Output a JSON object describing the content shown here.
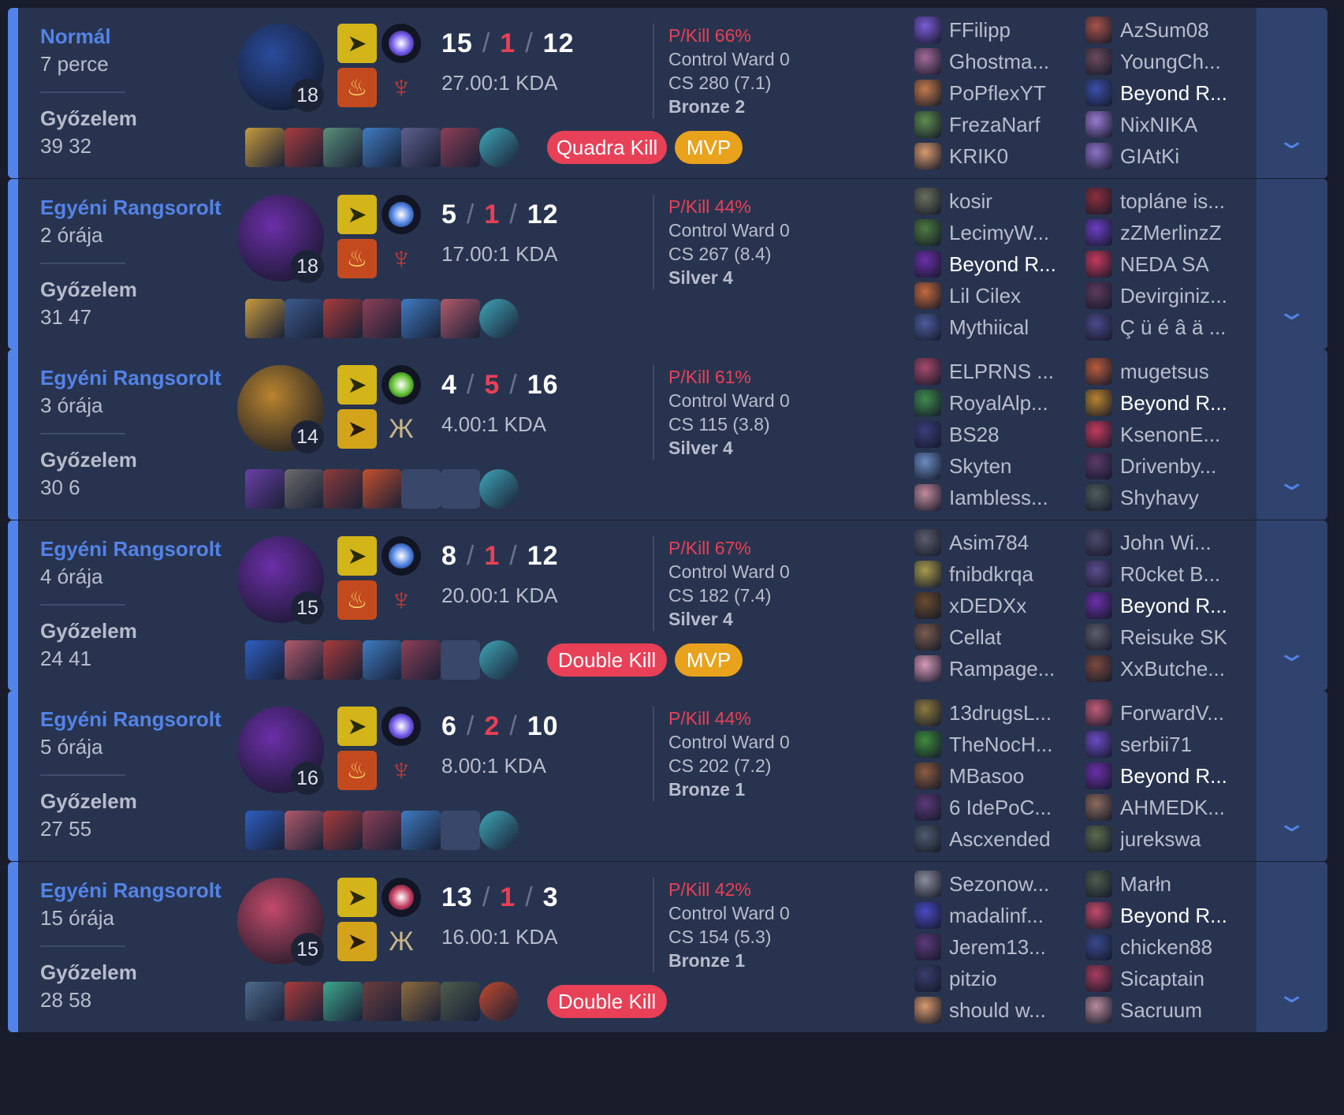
{
  "matches": [
    {
      "queue": "Normál",
      "ago": "7 perce",
      "result": "Győzelem",
      "length": "39 32",
      "level": "18",
      "kills": "15",
      "deaths": "1",
      "assists": "12",
      "ratio": "27.00:1 KDA",
      "pkill": "P/Kill 66%",
      "control_ward": "Control Ward 0",
      "cs": "CS 280 (7.1)",
      "rank": "Bronze 2",
      "champion_color": "#2a4c9c",
      "spell1_icon": "flash-icon",
      "spell2_icon": "ignite-icon",
      "rune1_color": "#6f56e8",
      "rune2_icon": "domination-icon",
      "items": [
        {
          "icon": "item-icon",
          "color": "#c89b3c"
        },
        {
          "icon": "item-icon",
          "color": "#a83c3c"
        },
        {
          "icon": "item-icon",
          "color": "#5a8f7b"
        },
        {
          "icon": "item-icon",
          "color": "#3e7cc2"
        },
        {
          "icon": "item-icon",
          "color": "#5d5f8c"
        },
        {
          "icon": "item-icon",
          "color": "#8c3f56"
        },
        {
          "icon": "ward-icon",
          "color": "#3fa6b8"
        }
      ],
      "badges": [
        {
          "label": "Quadra Kill",
          "type": "multi"
        },
        {
          "label": "MVP",
          "type": "mvp"
        }
      ],
      "team_blue": [
        {
          "name": "FFilipp",
          "color": "#7b5cd6"
        },
        {
          "name": "Ghostma...",
          "color": "#a36b9a"
        },
        {
          "name": "PoPflexYT",
          "color": "#c47a4a"
        },
        {
          "name": "FrezaNarf",
          "color": "#5f8c4d"
        },
        {
          "name": "KRIK0",
          "color": "#d99a6c"
        }
      ],
      "team_red": [
        {
          "name": "AzSum08",
          "color": "#a8534b"
        },
        {
          "name": "YoungCh...",
          "color": "#6a4a5c"
        },
        {
          "name": "Beyond R...",
          "color": "#3b4fa8",
          "me": true
        },
        {
          "name": "NixNIKA",
          "color": "#9b7ad1"
        },
        {
          "name": "GIAtKi",
          "color": "#8e72c9"
        }
      ]
    },
    {
      "queue": "Egyéni Rangsorolt",
      "ago": "2 órája",
      "result": "Győzelem",
      "length": "31 47",
      "level": "18",
      "kills": "5",
      "deaths": "1",
      "assists": "12",
      "ratio": "17.00:1 KDA",
      "pkill": "P/Kill 44%",
      "control_ward": "Control Ward 0",
      "cs": "CS 267 (8.4)",
      "rank": "Silver 4",
      "champion_color": "#6b2fa8",
      "spell1_icon": "flash-icon",
      "spell2_icon": "ignite-icon",
      "rune1_color": "#4a7fe0",
      "rune2_icon": "domination-icon",
      "items": [
        {
          "icon": "item-icon",
          "color": "#c89b3c"
        },
        {
          "icon": "item-icon",
          "color": "#3d5a8c"
        },
        {
          "icon": "item-icon",
          "color": "#a83c3c"
        },
        {
          "icon": "item-icon",
          "color": "#8c3f56"
        },
        {
          "icon": "item-icon",
          "color": "#3e7cc2"
        },
        {
          "icon": "item-icon",
          "color": "#b05a6b"
        },
        {
          "icon": "ward-icon",
          "color": "#3fa6b8"
        }
      ],
      "badges": [],
      "team_blue": [
        {
          "name": "kosir",
          "color": "#6b6f5c"
        },
        {
          "name": "LecimyW...",
          "color": "#4d7a3e"
        },
        {
          "name": "Beyond R...",
          "color": "#6b2fa8",
          "me": true
        },
        {
          "name": "Lil Cilex",
          "color": "#c46a3e"
        },
        {
          "name": "Mythiical",
          "color": "#4d5c9c"
        }
      ],
      "team_red": [
        {
          "name": "topláne is...",
          "color": "#8c2f3e"
        },
        {
          "name": "zZMerlinzZ",
          "color": "#6a3ec2"
        },
        {
          "name": "NEDA SA",
          "color": "#c43a5e"
        },
        {
          "name": "Devirginiz...",
          "color": "#5c3a5e"
        },
        {
          "name": "Ç ü é â ä ...",
          "color": "#4d4a8c"
        }
      ]
    },
    {
      "queue": "Egyéni Rangsorolt",
      "ago": "3 órája",
      "result": "Győzelem",
      "length": "30 6",
      "level": "14",
      "kills": "4",
      "deaths": "5",
      "assists": "16",
      "ratio": "4.00:1 KDA",
      "pkill": "P/Kill 61%",
      "control_ward": "Control Ward 0",
      "cs": "CS 115 (3.8)",
      "rank": "Silver 4",
      "champion_color": "#b8842e",
      "spell1_icon": "flash-icon",
      "spell2_icon": "exhaust-icon",
      "rune1_color": "#5fbf2e",
      "rune2_icon": "resolve-icon",
      "items": [
        {
          "icon": "item-icon",
          "color": "#6b3fa8"
        },
        {
          "icon": "item-icon",
          "color": "#6b6b6b"
        },
        {
          "icon": "item-icon",
          "color": "#8c3c3c"
        },
        {
          "icon": "item-icon",
          "color": "#c4502e"
        },
        {
          "icon": "empty-slot",
          "color": ""
        },
        {
          "icon": "empty-slot",
          "color": ""
        },
        {
          "icon": "ward-icon",
          "color": "#3fa6b8"
        }
      ],
      "badges": [],
      "team_blue": [
        {
          "name": "ELPRNS ...",
          "color": "#a84a6b"
        },
        {
          "name": "RoyalAlp...",
          "color": "#3e8c4d"
        },
        {
          "name": "BS28",
          "color": "#3a3e7a"
        },
        {
          "name": "Skyten",
          "color": "#6b8cc2"
        },
        {
          "name": "Iambless...",
          "color": "#c28c9c"
        }
      ],
      "team_red": [
        {
          "name": "mugetsus",
          "color": "#b85c3e"
        },
        {
          "name": "Beyond R...",
          "color": "#b8842e",
          "me": true
        },
        {
          "name": "KsenonE...",
          "color": "#c43a5e"
        },
        {
          "name": "Drivenby...",
          "color": "#5c3a6b"
        },
        {
          "name": "Shyhavy",
          "color": "#4d5c5c"
        }
      ]
    },
    {
      "queue": "Egyéni Rangsorolt",
      "ago": "4 órája",
      "result": "Győzelem",
      "length": "24 41",
      "level": "15",
      "kills": "8",
      "deaths": "1",
      "assists": "12",
      "ratio": "20.00:1 KDA",
      "pkill": "P/Kill 67%",
      "control_ward": "Control Ward 0",
      "cs": "CS 182 (7.4)",
      "rank": "Silver 4",
      "champion_color": "#6b2fa8",
      "spell1_icon": "flash-icon",
      "spell2_icon": "ignite-icon",
      "rune1_color": "#4a7fe0",
      "rune2_icon": "domination-icon",
      "items": [
        {
          "icon": "item-icon",
          "color": "#2e5ec2"
        },
        {
          "icon": "item-icon",
          "color": "#b05a6b"
        },
        {
          "icon": "item-icon",
          "color": "#a83c3c"
        },
        {
          "icon": "item-icon",
          "color": "#3e7cc2"
        },
        {
          "icon": "item-icon",
          "color": "#8c3f56"
        },
        {
          "icon": "empty-slot",
          "color": ""
        },
        {
          "icon": "ward-icon",
          "color": "#3fa6b8"
        }
      ],
      "badges": [
        {
          "label": "Double Kill",
          "type": "multi"
        },
        {
          "label": "MVP",
          "type": "mvp"
        }
      ],
      "team_blue": [
        {
          "name": "Asim784",
          "color": "#5c5c6b"
        },
        {
          "name": "fnibdkrqa",
          "color": "#a89c4d"
        },
        {
          "name": "xDEDXx",
          "color": "#6b4a2e"
        },
        {
          "name": "Cellat",
          "color": "#7a5c4d"
        },
        {
          "name": "Rampage...",
          "color": "#d99ab8"
        }
      ],
      "team_red": [
        {
          "name": "John Wi...",
          "color": "#4d4a6b"
        },
        {
          "name": "R0cket B...",
          "color": "#5c4d8c"
        },
        {
          "name": "Beyond R...",
          "color": "#6b2fa8",
          "me": true
        },
        {
          "name": "Reisuke SK",
          "color": "#5c5c6b"
        },
        {
          "name": "XxButche...",
          "color": "#7a4a3e"
        }
      ]
    },
    {
      "queue": "Egyéni Rangsorolt",
      "ago": "5 órája",
      "result": "Győzelem",
      "length": "27 55",
      "level": "16",
      "kills": "6",
      "deaths": "2",
      "assists": "10",
      "ratio": "8.00:1 KDA",
      "pkill": "P/Kill 44%",
      "control_ward": "Control Ward 0",
      "cs": "CS 202 (7.2)",
      "rank": "Bronze 1",
      "champion_color": "#6b2fa8",
      "spell1_icon": "flash-icon",
      "spell2_icon": "ignite-icon",
      "rune1_color": "#6f56e8",
      "rune2_icon": "domination-icon",
      "items": [
        {
          "icon": "item-icon",
          "color": "#2e5ec2"
        },
        {
          "icon": "item-icon",
          "color": "#b05a6b"
        },
        {
          "icon": "item-icon",
          "color": "#a83c3c"
        },
        {
          "icon": "item-icon",
          "color": "#8c3f56"
        },
        {
          "icon": "item-icon",
          "color": "#3e7cc2"
        },
        {
          "icon": "empty-slot",
          "color": ""
        },
        {
          "icon": "ward-icon",
          "color": "#3fa6b8"
        }
      ],
      "badges": [],
      "team_blue": [
        {
          "name": "13drugsL...",
          "color": "#8c7a3e"
        },
        {
          "name": "TheNocH...",
          "color": "#3e8c3e"
        },
        {
          "name": "MBasoo",
          "color": "#8c5c3e"
        },
        {
          "name": "6 IdePoC...",
          "color": "#5c3a7a"
        },
        {
          "name": "Ascxended",
          "color": "#4d5c6b"
        }
      ],
      "team_red": [
        {
          "name": "ForwardV...",
          "color": "#c25c7a"
        },
        {
          "name": "serbii71",
          "color": "#6a4ac2"
        },
        {
          "name": "Beyond R...",
          "color": "#6b2fa8",
          "me": true
        },
        {
          "name": "AHMEDK...",
          "color": "#8c6b5c"
        },
        {
          "name": "jurekswa",
          "color": "#5c6b4d"
        }
      ]
    },
    {
      "queue": "Egyéni Rangsorolt",
      "ago": "15 órája",
      "result": "Győzelem",
      "length": "28 58",
      "level": "15",
      "kills": "13",
      "deaths": "1",
      "assists": "3",
      "ratio": "16.00:1 KDA",
      "pkill": "P/Kill 42%",
      "control_ward": "Control Ward 0",
      "cs": "CS 154 (5.3)",
      "rank": "Bronze 1",
      "champion_color": "#c24a6b",
      "spell1_icon": "flash-icon",
      "spell2_icon": "exhaust-icon",
      "rune1_color": "#c23a5e",
      "rune2_icon": "resolve-icon",
      "items": [
        {
          "icon": "item-icon",
          "color": "#4d6b8c"
        },
        {
          "icon": "item-icon",
          "color": "#a83c3c"
        },
        {
          "icon": "item-icon",
          "color": "#3ea88c"
        },
        {
          "icon": "item-icon",
          "color": "#6b3e3e"
        },
        {
          "icon": "item-icon",
          "color": "#8c6b3e"
        },
        {
          "icon": "item-icon",
          "color": "#4d5c4d"
        },
        {
          "icon": "trinket-icon",
          "color": "#c24a2e"
        }
      ],
      "badges": [
        {
          "label": "Double Kill",
          "type": "multi"
        }
      ],
      "team_blue": [
        {
          "name": "Sezonow...",
          "color": "#8c8c9c"
        },
        {
          "name": "madalinf...",
          "color": "#4a4ac2"
        },
        {
          "name": "Jerem13...",
          "color": "#5c3a7a"
        },
        {
          "name": "pitzio",
          "color": "#3a3e6b"
        },
        {
          "name": "should w...",
          "color": "#d99a6c"
        }
      ],
      "team_red": [
        {
          "name": "Marłn",
          "color": "#4d5c4d"
        },
        {
          "name": "Beyond R...",
          "color": "#c24a6b",
          "me": true
        },
        {
          "name": "chicken88",
          "color": "#3a4a8c"
        },
        {
          "name": "Sicaptain",
          "color": "#a83c5e"
        },
        {
          "name": "Sacruum",
          "color": "#b88c9c"
        }
      ]
    }
  ]
}
